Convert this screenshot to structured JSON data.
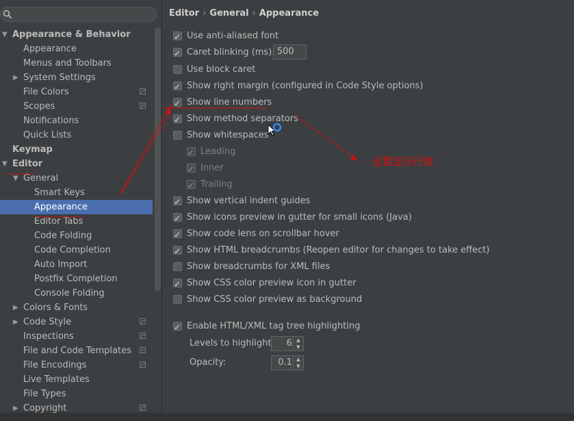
{
  "search": {
    "icon": "search-icon",
    "value": ""
  },
  "tree": [
    {
      "label": "Appearance & Behavior",
      "bold": true,
      "arrow": "down"
    },
    {
      "label": "Appearance"
    },
    {
      "label": "Menus and Toolbars"
    },
    {
      "label": "System Settings",
      "arrow": "right"
    },
    {
      "label": "File Colors",
      "project": true
    },
    {
      "label": "Scopes",
      "project": true
    },
    {
      "label": "Notifications"
    },
    {
      "label": "Quick Lists"
    },
    {
      "label": "Keymap",
      "bold": true
    },
    {
      "label": "Editor",
      "bold": true,
      "arrow": "down"
    },
    {
      "label": "General",
      "arrow": "down"
    },
    {
      "label": "Smart Keys"
    },
    {
      "label": "Appearance",
      "selected": true
    },
    {
      "label": "Editor Tabs"
    },
    {
      "label": "Code Folding"
    },
    {
      "label": "Code Completion"
    },
    {
      "label": "Auto Import"
    },
    {
      "label": "Postfix Completion"
    },
    {
      "label": "Console Folding"
    },
    {
      "label": "Colors & Fonts",
      "arrow": "right"
    },
    {
      "label": "Code Style",
      "arrow": "right",
      "project": true
    },
    {
      "label": "Inspections",
      "project": true
    },
    {
      "label": "File and Code Templates",
      "project": true
    },
    {
      "label": "File Encodings",
      "project": true
    },
    {
      "label": "Live Templates"
    },
    {
      "label": "File Types"
    },
    {
      "label": "Copyright",
      "arrow": "right",
      "project": true
    }
  ],
  "breadcrumb": [
    "Editor",
    "General",
    "Appearance"
  ],
  "breadcrumb_sep": "›",
  "options": [
    {
      "label": "Use anti-aliased font",
      "checked": true
    },
    {
      "label": "Caret blinking (ms):",
      "checked": true,
      "input": "500"
    },
    {
      "label": "Use block caret",
      "checked": false
    },
    {
      "label": "Show right margin (configured in Code Style options)",
      "checked": true
    },
    {
      "label": "Show line numbers",
      "checked": true
    },
    {
      "label": "Show method separators",
      "checked": true
    },
    {
      "label": "Show whitespaces",
      "checked": false
    },
    {
      "label": "Leading",
      "checked": true,
      "disabled": true
    },
    {
      "label": "Inner",
      "checked": true,
      "disabled": true
    },
    {
      "label": "Trailing",
      "checked": true,
      "disabled": true
    },
    {
      "label": "Show vertical indent guides",
      "checked": true
    },
    {
      "label": "Show icons preview in gutter for small icons (Java)",
      "checked": true
    },
    {
      "label": "Show code lens on scrollbar hover",
      "checked": true
    },
    {
      "label": "Show HTML breadcrumbs (Reopen editor for changes to take effect)",
      "checked": true
    },
    {
      "label": "Show breadcrumbs for XML files",
      "checked": false
    },
    {
      "label": "Show CSS color preview icon in gutter",
      "checked": true
    },
    {
      "label": "Show CSS color preview as background",
      "checked": false
    },
    {
      "label": "Enable HTML/XML tag tree highlighting",
      "checked": true
    }
  ],
  "levels": {
    "label": "Levels to highlight:",
    "value": "6"
  },
  "opacity": {
    "label": "Opacity:",
    "value": "0.1"
  },
  "annotation": {
    "text": "设置显示行数",
    "color": "#d01010"
  },
  "colors": {
    "bg": "#3c3f41",
    "selection": "#4b6eaf",
    "annotation": "#d01010"
  }
}
